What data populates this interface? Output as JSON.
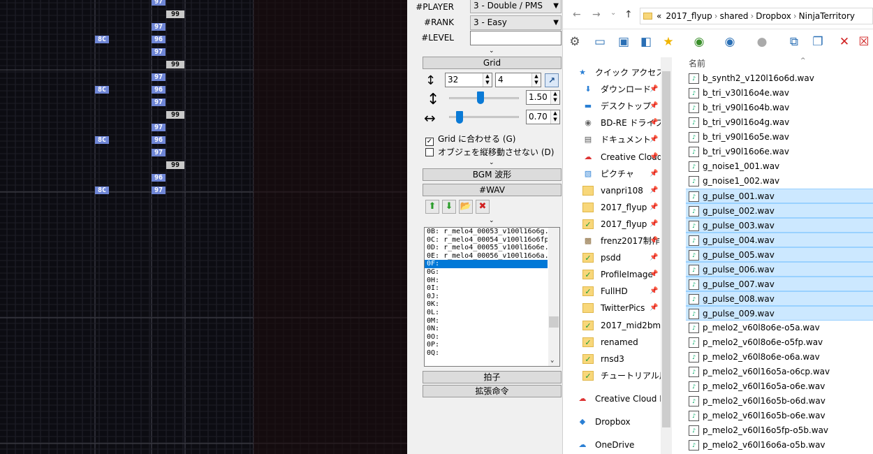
{
  "grid": {
    "notes": [
      {
        "label": "97",
        "color": "blue",
        "col": 2,
        "row": 0
      },
      {
        "label": "99",
        "color": "gray",
        "col": 3,
        "row": 1
      },
      {
        "label": "97",
        "color": "blue",
        "col": 2,
        "row": 2
      },
      {
        "label": "8C",
        "color": "blue",
        "col": 1,
        "row": 3
      },
      {
        "label": "96",
        "color": "blue",
        "col": 2,
        "row": 3
      },
      {
        "label": "97",
        "color": "blue",
        "col": 2,
        "row": 4
      },
      {
        "label": "99",
        "color": "gray",
        "col": 3,
        "row": 5
      },
      {
        "label": "97",
        "color": "blue",
        "col": 2,
        "row": 6
      },
      {
        "label": "8C",
        "color": "blue",
        "col": 1,
        "row": 7
      },
      {
        "label": "96",
        "color": "blue",
        "col": 2,
        "row": 7
      },
      {
        "label": "97",
        "color": "blue",
        "col": 2,
        "row": 8
      },
      {
        "label": "99",
        "color": "gray",
        "col": 3,
        "row": 9
      },
      {
        "label": "97",
        "color": "blue",
        "col": 2,
        "row": 10
      },
      {
        "label": "8C",
        "color": "blue",
        "col": 1,
        "row": 11
      },
      {
        "label": "96",
        "color": "blue",
        "col": 2,
        "row": 11
      },
      {
        "label": "97",
        "color": "blue",
        "col": 2,
        "row": 12
      },
      {
        "label": "99",
        "color": "gray",
        "col": 3,
        "row": 13
      },
      {
        "label": "96",
        "color": "blue",
        "col": 2,
        "row": 14
      },
      {
        "label": "8C",
        "color": "blue",
        "col": 1,
        "row": 15
      },
      {
        "label": "97",
        "color": "blue",
        "col": 2,
        "row": 15
      }
    ]
  },
  "header": {
    "player_label": "#PLAYER",
    "player_value": "3 - Double / PMS",
    "rank_label": "#RANK",
    "rank_value": "3 - Easy",
    "level_label": "#LEVEL",
    "level_value": ""
  },
  "grid_section": {
    "title": "Grid",
    "grid_value": "32",
    "measure_value": "4",
    "vzoom_value": "1.50",
    "hzoom_value": "0.70",
    "vzoom_level": 0.45,
    "hzoom_level": 0.15,
    "snap_label": "Grid に合わせる (G)",
    "snap_checked": true,
    "novert_label": "オブジェを縦移動させない (D)",
    "novert_checked": false
  },
  "sections": {
    "bgm": "BGM 波形",
    "wav": "#WAV",
    "beat": "拍子",
    "ext": "拡張命令"
  },
  "wav_list": [
    {
      "text": "0B: r_melo4_00053_v100l16o6g.",
      "sel": false
    },
    {
      "text": "0C: r_melo4_00054_v100l16o6fp",
      "sel": false
    },
    {
      "text": "0D: r_melo4_00055_v100l16o6e.",
      "sel": false
    },
    {
      "text": "0E: r_melo4_00056_v100l16o6a.",
      "sel": false
    },
    {
      "text": "0F:",
      "sel": true
    },
    {
      "text": "0G:",
      "sel": false
    },
    {
      "text": "0H:",
      "sel": false
    },
    {
      "text": "0I:",
      "sel": false
    },
    {
      "text": "0J:",
      "sel": false
    },
    {
      "text": "0K:",
      "sel": false
    },
    {
      "text": "0L:",
      "sel": false
    },
    {
      "text": "0M:",
      "sel": false
    },
    {
      "text": "0N:",
      "sel": false
    },
    {
      "text": "0O:",
      "sel": false
    },
    {
      "text": "0P:",
      "sel": false
    },
    {
      "text": "0Q:",
      "sel": false
    }
  ],
  "explorer": {
    "path": [
      "«",
      "2017_flyup",
      "shared",
      "Dropbox",
      "NinjaTerritory"
    ],
    "column_name": "名前",
    "nav_items": [
      {
        "text": "クイック アクセス",
        "icon": "star",
        "pin": false
      },
      {
        "text": "ダウンロード",
        "icon": "download",
        "pin": true
      },
      {
        "text": "デスクトップ",
        "icon": "desktop",
        "pin": true
      },
      {
        "text": "BD-RE ドライブ",
        "icon": "disc",
        "pin": true
      },
      {
        "text": "ドキュメント",
        "icon": "document",
        "pin": true
      },
      {
        "text": "Creative Cloud",
        "icon": "cloud",
        "pin": true
      },
      {
        "text": "ピクチャ",
        "icon": "picture",
        "pin": true
      },
      {
        "text": "vanpri108",
        "icon": "folder",
        "pin": true
      },
      {
        "text": "2017_flyup",
        "icon": "folder",
        "pin": true
      },
      {
        "text": "2017_flyup",
        "icon": "folder-sync",
        "pin": true
      },
      {
        "text": "frenz2017制作",
        "icon": "image",
        "pin": true
      },
      {
        "text": "psdd",
        "icon": "folder-sync",
        "pin": true
      },
      {
        "text": "ProfileImage",
        "icon": "folder-sync",
        "pin": true
      },
      {
        "text": "FullHD",
        "icon": "folder-sync",
        "pin": true
      },
      {
        "text": "TwitterPics",
        "icon": "folder",
        "pin": true
      },
      {
        "text": "2017_mid2bms",
        "icon": "folder-sync",
        "pin": false
      },
      {
        "text": "renamed",
        "icon": "folder-sync",
        "pin": false
      },
      {
        "text": "rnsd3",
        "icon": "folder-sync",
        "pin": false
      },
      {
        "text": "チュートリアル用",
        "icon": "folder-sync",
        "pin": false
      },
      {
        "text": "Creative Cloud Files",
        "icon": "cloud",
        "pin": false
      },
      {
        "text": "Dropbox",
        "icon": "dropbox",
        "pin": false
      },
      {
        "text": "OneDrive",
        "icon": "onedrive",
        "pin": false
      }
    ],
    "files": [
      {
        "name": "b_synth2_v120l16o6d.wav",
        "sel": false
      },
      {
        "name": "b_tri_v30l16o4e.wav",
        "sel": false
      },
      {
        "name": "b_tri_v90l16o4b.wav",
        "sel": false
      },
      {
        "name": "b_tri_v90l16o4g.wav",
        "sel": false
      },
      {
        "name": "b_tri_v90l16o5e.wav",
        "sel": false
      },
      {
        "name": "b_tri_v90l16o6e.wav",
        "sel": false
      },
      {
        "name": "g_noise1_001.wav",
        "sel": false
      },
      {
        "name": "g_noise1_002.wav",
        "sel": false
      },
      {
        "name": "g_pulse_001.wav",
        "sel": true
      },
      {
        "name": "g_pulse_002.wav",
        "sel": true
      },
      {
        "name": "g_pulse_003.wav",
        "sel": true
      },
      {
        "name": "g_pulse_004.wav",
        "sel": true
      },
      {
        "name": "g_pulse_005.wav",
        "sel": true
      },
      {
        "name": "g_pulse_006.wav",
        "sel": true
      },
      {
        "name": "g_pulse_007.wav",
        "sel": true
      },
      {
        "name": "g_pulse_008.wav",
        "sel": true
      },
      {
        "name": "g_pulse_009.wav",
        "sel": true
      },
      {
        "name": "p_melo2_v60l8o6e-o5a.wav",
        "sel": false
      },
      {
        "name": "p_melo2_v60l8o6e-o5fp.wav",
        "sel": false
      },
      {
        "name": "p_melo2_v60l8o6e-o6a.wav",
        "sel": false
      },
      {
        "name": "p_melo2_v60l16o5a-o6cp.wav",
        "sel": false
      },
      {
        "name": "p_melo2_v60l16o5a-o6e.wav",
        "sel": false
      },
      {
        "name": "p_melo2_v60l16o5b-o6d.wav",
        "sel": false
      },
      {
        "name": "p_melo2_v60l16o5b-o6e.wav",
        "sel": false
      },
      {
        "name": "p_melo2_v60l16o5fp-o5b.wav",
        "sel": false
      },
      {
        "name": "p_melo2_v60l16o6a-o5b.wav",
        "sel": false
      }
    ]
  }
}
